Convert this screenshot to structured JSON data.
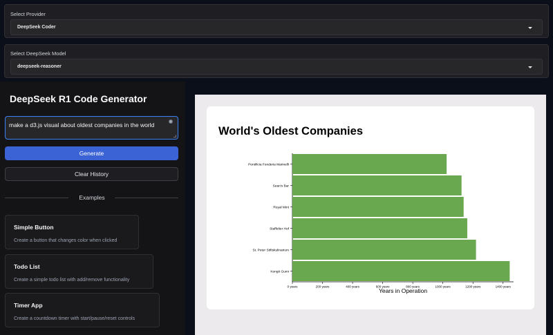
{
  "provider": {
    "label": "Select Provider",
    "selected": "DeepSeek Coder"
  },
  "model": {
    "label": "Select DeepSeek Model",
    "selected": "deepseek-reasoner"
  },
  "app": {
    "title": "DeepSeek R1 Code Generator",
    "prompt_value": "make a d3.js visual about oldest companies in the world",
    "generate_label": "Generate",
    "clear_label": "Clear History",
    "examples_label": "Examples"
  },
  "examples": [
    {
      "title": "Simple Button",
      "description": "Create a button that changes color when clicked"
    },
    {
      "title": "Todo List",
      "description": "Create a simple todo list with add/remove functionality"
    },
    {
      "title": "Timer App",
      "description": "Create a countdown timer with start/pause/reset controls"
    }
  ],
  "colors": {
    "accent": "#3b63d6",
    "bar": "#6aa84f"
  },
  "chart_data": {
    "type": "bar",
    "orientation": "horizontal",
    "title": "World's Oldest Companies",
    "xlabel": "Years in Operation",
    "ylabel": "",
    "categories": [
      "Pontificia Fonderia Marinelli",
      "Sean's Bar",
      "Royal Mint",
      "Staffelter Hof",
      "St. Peter Stiftskulinarium",
      "Kongō Gumi"
    ],
    "values": [
      1025,
      1124,
      1138,
      1162,
      1220,
      1444
    ],
    "xlim": [
      0,
      1470
    ],
    "xticks": [
      0,
      200,
      400,
      600,
      800,
      1000,
      1200,
      1400
    ],
    "xtick_labels": [
      "0 years",
      "200 years",
      "400 years",
      "600 years",
      "800 years",
      "1000 years",
      "1200 years",
      "1400 years"
    ],
    "grid": false,
    "legend": "none"
  }
}
